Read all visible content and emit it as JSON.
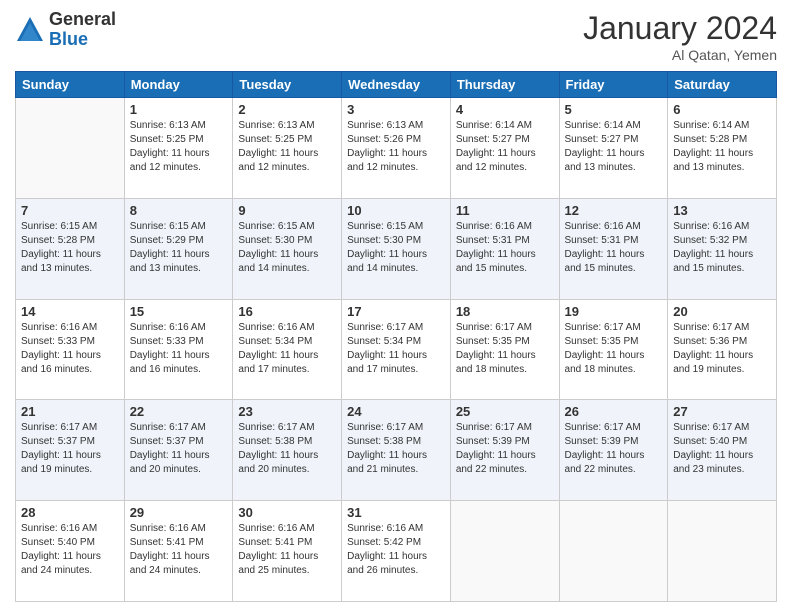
{
  "logo": {
    "general": "General",
    "blue": "Blue"
  },
  "title": "January 2024",
  "location": "Al Qatan, Yemen",
  "days_header": [
    "Sunday",
    "Monday",
    "Tuesday",
    "Wednesday",
    "Thursday",
    "Friday",
    "Saturday"
  ],
  "weeks": [
    [
      {
        "day": "",
        "sunrise": "",
        "sunset": "",
        "daylight": "",
        "empty": true
      },
      {
        "day": "1",
        "sunrise": "Sunrise: 6:13 AM",
        "sunset": "Sunset: 5:25 PM",
        "daylight": "Daylight: 11 hours and 12 minutes."
      },
      {
        "day": "2",
        "sunrise": "Sunrise: 6:13 AM",
        "sunset": "Sunset: 5:25 PM",
        "daylight": "Daylight: 11 hours and 12 minutes."
      },
      {
        "day": "3",
        "sunrise": "Sunrise: 6:13 AM",
        "sunset": "Sunset: 5:26 PM",
        "daylight": "Daylight: 11 hours and 12 minutes."
      },
      {
        "day": "4",
        "sunrise": "Sunrise: 6:14 AM",
        "sunset": "Sunset: 5:27 PM",
        "daylight": "Daylight: 11 hours and 12 minutes."
      },
      {
        "day": "5",
        "sunrise": "Sunrise: 6:14 AM",
        "sunset": "Sunset: 5:27 PM",
        "daylight": "Daylight: 11 hours and 13 minutes."
      },
      {
        "day": "6",
        "sunrise": "Sunrise: 6:14 AM",
        "sunset": "Sunset: 5:28 PM",
        "daylight": "Daylight: 11 hours and 13 minutes."
      }
    ],
    [
      {
        "day": "7",
        "sunrise": "Sunrise: 6:15 AM",
        "sunset": "Sunset: 5:28 PM",
        "daylight": "Daylight: 11 hours and 13 minutes."
      },
      {
        "day": "8",
        "sunrise": "Sunrise: 6:15 AM",
        "sunset": "Sunset: 5:29 PM",
        "daylight": "Daylight: 11 hours and 13 minutes."
      },
      {
        "day": "9",
        "sunrise": "Sunrise: 6:15 AM",
        "sunset": "Sunset: 5:30 PM",
        "daylight": "Daylight: 11 hours and 14 minutes."
      },
      {
        "day": "10",
        "sunrise": "Sunrise: 6:15 AM",
        "sunset": "Sunset: 5:30 PM",
        "daylight": "Daylight: 11 hours and 14 minutes."
      },
      {
        "day": "11",
        "sunrise": "Sunrise: 6:16 AM",
        "sunset": "Sunset: 5:31 PM",
        "daylight": "Daylight: 11 hours and 15 minutes."
      },
      {
        "day": "12",
        "sunrise": "Sunrise: 6:16 AM",
        "sunset": "Sunset: 5:31 PM",
        "daylight": "Daylight: 11 hours and 15 minutes."
      },
      {
        "day": "13",
        "sunrise": "Sunrise: 6:16 AM",
        "sunset": "Sunset: 5:32 PM",
        "daylight": "Daylight: 11 hours and 15 minutes."
      }
    ],
    [
      {
        "day": "14",
        "sunrise": "Sunrise: 6:16 AM",
        "sunset": "Sunset: 5:33 PM",
        "daylight": "Daylight: 11 hours and 16 minutes."
      },
      {
        "day": "15",
        "sunrise": "Sunrise: 6:16 AM",
        "sunset": "Sunset: 5:33 PM",
        "daylight": "Daylight: 11 hours and 16 minutes."
      },
      {
        "day": "16",
        "sunrise": "Sunrise: 6:16 AM",
        "sunset": "Sunset: 5:34 PM",
        "daylight": "Daylight: 11 hours and 17 minutes."
      },
      {
        "day": "17",
        "sunrise": "Sunrise: 6:17 AM",
        "sunset": "Sunset: 5:34 PM",
        "daylight": "Daylight: 11 hours and 17 minutes."
      },
      {
        "day": "18",
        "sunrise": "Sunrise: 6:17 AM",
        "sunset": "Sunset: 5:35 PM",
        "daylight": "Daylight: 11 hours and 18 minutes."
      },
      {
        "day": "19",
        "sunrise": "Sunrise: 6:17 AM",
        "sunset": "Sunset: 5:35 PM",
        "daylight": "Daylight: 11 hours and 18 minutes."
      },
      {
        "day": "20",
        "sunrise": "Sunrise: 6:17 AM",
        "sunset": "Sunset: 5:36 PM",
        "daylight": "Daylight: 11 hours and 19 minutes."
      }
    ],
    [
      {
        "day": "21",
        "sunrise": "Sunrise: 6:17 AM",
        "sunset": "Sunset: 5:37 PM",
        "daylight": "Daylight: 11 hours and 19 minutes."
      },
      {
        "day": "22",
        "sunrise": "Sunrise: 6:17 AM",
        "sunset": "Sunset: 5:37 PM",
        "daylight": "Daylight: 11 hours and 20 minutes."
      },
      {
        "day": "23",
        "sunrise": "Sunrise: 6:17 AM",
        "sunset": "Sunset: 5:38 PM",
        "daylight": "Daylight: 11 hours and 20 minutes."
      },
      {
        "day": "24",
        "sunrise": "Sunrise: 6:17 AM",
        "sunset": "Sunset: 5:38 PM",
        "daylight": "Daylight: 11 hours and 21 minutes."
      },
      {
        "day": "25",
        "sunrise": "Sunrise: 6:17 AM",
        "sunset": "Sunset: 5:39 PM",
        "daylight": "Daylight: 11 hours and 22 minutes."
      },
      {
        "day": "26",
        "sunrise": "Sunrise: 6:17 AM",
        "sunset": "Sunset: 5:39 PM",
        "daylight": "Daylight: 11 hours and 22 minutes."
      },
      {
        "day": "27",
        "sunrise": "Sunrise: 6:17 AM",
        "sunset": "Sunset: 5:40 PM",
        "daylight": "Daylight: 11 hours and 23 minutes."
      }
    ],
    [
      {
        "day": "28",
        "sunrise": "Sunrise: 6:16 AM",
        "sunset": "Sunset: 5:40 PM",
        "daylight": "Daylight: 11 hours and 24 minutes."
      },
      {
        "day": "29",
        "sunrise": "Sunrise: 6:16 AM",
        "sunset": "Sunset: 5:41 PM",
        "daylight": "Daylight: 11 hours and 24 minutes."
      },
      {
        "day": "30",
        "sunrise": "Sunrise: 6:16 AM",
        "sunset": "Sunset: 5:41 PM",
        "daylight": "Daylight: 11 hours and 25 minutes."
      },
      {
        "day": "31",
        "sunrise": "Sunrise: 6:16 AM",
        "sunset": "Sunset: 5:42 PM",
        "daylight": "Daylight: 11 hours and 26 minutes."
      },
      {
        "day": "",
        "sunrise": "",
        "sunset": "",
        "daylight": "",
        "empty": true
      },
      {
        "day": "",
        "sunrise": "",
        "sunset": "",
        "daylight": "",
        "empty": true
      },
      {
        "day": "",
        "sunrise": "",
        "sunset": "",
        "daylight": "",
        "empty": true
      }
    ]
  ]
}
